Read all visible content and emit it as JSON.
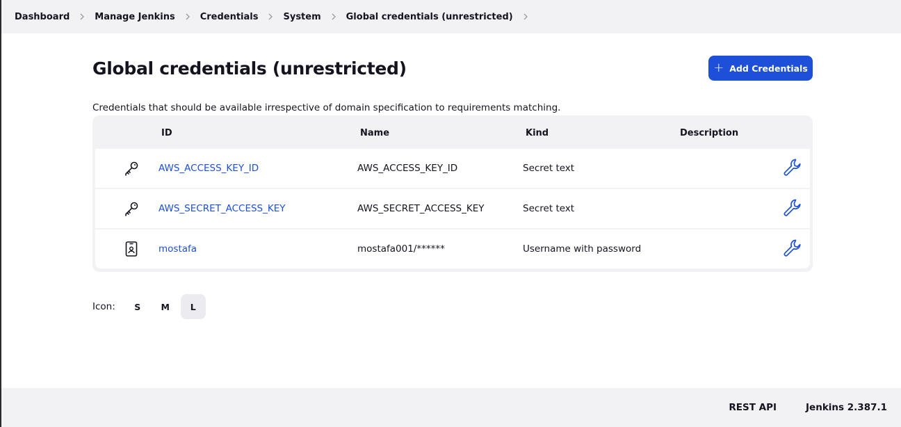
{
  "breadcrumbs": [
    {
      "label": "Dashboard"
    },
    {
      "label": "Manage Jenkins"
    },
    {
      "label": "Credentials"
    },
    {
      "label": "System"
    },
    {
      "label": "Global credentials (unrestricted)"
    }
  ],
  "page": {
    "title": "Global credentials (unrestricted)",
    "add_button_label": "Add Credentials",
    "description": "Credentials that should be available irrespective of domain specification to requirements matching."
  },
  "table": {
    "headers": {
      "id": "ID",
      "name": "Name",
      "kind": "Kind",
      "description": "Description"
    },
    "rows": [
      {
        "icon": "key-icon",
        "id": "AWS_ACCESS_KEY_ID",
        "name": "AWS_ACCESS_KEY_ID",
        "kind": "Secret text",
        "description": ""
      },
      {
        "icon": "key-icon",
        "id": "AWS_SECRET_ACCESS_KEY",
        "name": "AWS_SECRET_ACCESS_KEY",
        "kind": "Secret text",
        "description": ""
      },
      {
        "icon": "id-badge-icon",
        "id": "mostafa",
        "name": "mostafa001/******",
        "kind": "Username with password",
        "description": ""
      }
    ]
  },
  "icon_size": {
    "label": "Icon:",
    "options": [
      "S",
      "M",
      "L"
    ],
    "selected": "L"
  },
  "footer": {
    "rest_api": "REST API",
    "version": "Jenkins 2.387.1"
  },
  "colors": {
    "accent": "#1d4fd8",
    "header_bg": "#f2f2f5"
  }
}
